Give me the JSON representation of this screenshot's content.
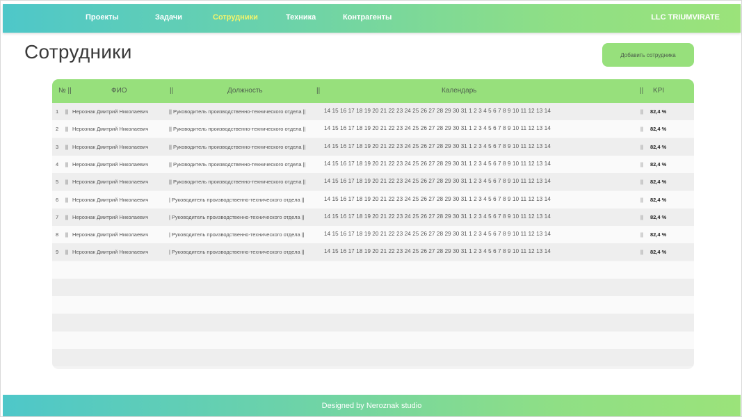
{
  "nav": {
    "items": [
      {
        "label": "Проекты",
        "active": false
      },
      {
        "label": "Задачи",
        "active": false
      },
      {
        "label": "Сотрудники",
        "active": true
      },
      {
        "label": "Техника",
        "active": false
      },
      {
        "label": "Контрагенты",
        "active": false
      }
    ],
    "brand": "LLC TRIUMVIRATE"
  },
  "page": {
    "title": "Сотрудники",
    "add_button": "Добавить сотрудника"
  },
  "table": {
    "headers": {
      "num": "№ ||",
      "fio": "ФИО",
      "sep1": "||",
      "position": "Должность",
      "sep2": "||",
      "calendar": "Календарь",
      "sep3": "||",
      "kpi": "KPI"
    },
    "days": "14  15  16  17  18  19  20  21  22  23  24  25  26  27  28  29  30  31  1  2  3  4  5  6  7  8  9  10  11  12  13  14",
    "rows": [
      {
        "num": "1",
        "sep_a": "||",
        "fio": "Нерознак Дмитрий Николаевич",
        "position": "|| Руководитель производственно-технического отдела ||",
        "sep_b": "||",
        "kpi": "82,4 %"
      },
      {
        "num": "2",
        "sep_a": "||",
        "fio": "Нерознак Дмитрий Николаевич",
        "position": "|| Руководитель производственно-технического отдела ||",
        "sep_b": "||",
        "kpi": "82,4 %"
      },
      {
        "num": "3",
        "sep_a": "||",
        "fio": "Нерознак Дмитрий Николаевич",
        "position": "|| Руководитель производственно-технического отдела ||",
        "sep_b": "||",
        "kpi": "82,4 %"
      },
      {
        "num": "4",
        "sep_a": "||",
        "fio": "Нерознак Дмитрий Николаевич",
        "position": "|| Руководитель производственно-технического отдела ||",
        "sep_b": "||",
        "kpi": "82,4 %"
      },
      {
        "num": "5",
        "sep_a": "||",
        "fio": "Нерознак Дмитрий Николаевич",
        "position": "|| Руководитель производственно-технического отдела ||",
        "sep_b": "||",
        "kpi": "82,4 %"
      },
      {
        "num": "6",
        "sep_a": "||",
        "fio": "Нерознак Дмитрий Николаевич",
        "position": "| Руководитель производственно-технического отдела ||",
        "sep_b": "||",
        "kpi": "82,4 %"
      },
      {
        "num": "7",
        "sep_a": "||",
        "fio": "Нерознак Дмитрий Николаевич",
        "position": "| Руководитель производственно-технического отдела ||",
        "sep_b": "||",
        "kpi": "82,4 %"
      },
      {
        "num": "8",
        "sep_a": "||",
        "fio": "Нерознак Дмитрий Николаевич",
        "position": "| Руководитель производственно-технического отдела ||",
        "sep_b": "||",
        "kpi": "82,4 %"
      },
      {
        "num": "9",
        "sep_a": "||",
        "fio": "Нерознак Дмитрий Николаевич",
        "position": "| Руководитель производственно-технического отдела ||",
        "sep_b": "||",
        "kpi": "82,4 %"
      }
    ]
  },
  "footer": {
    "text": "Designed by Neroznak studio"
  }
}
